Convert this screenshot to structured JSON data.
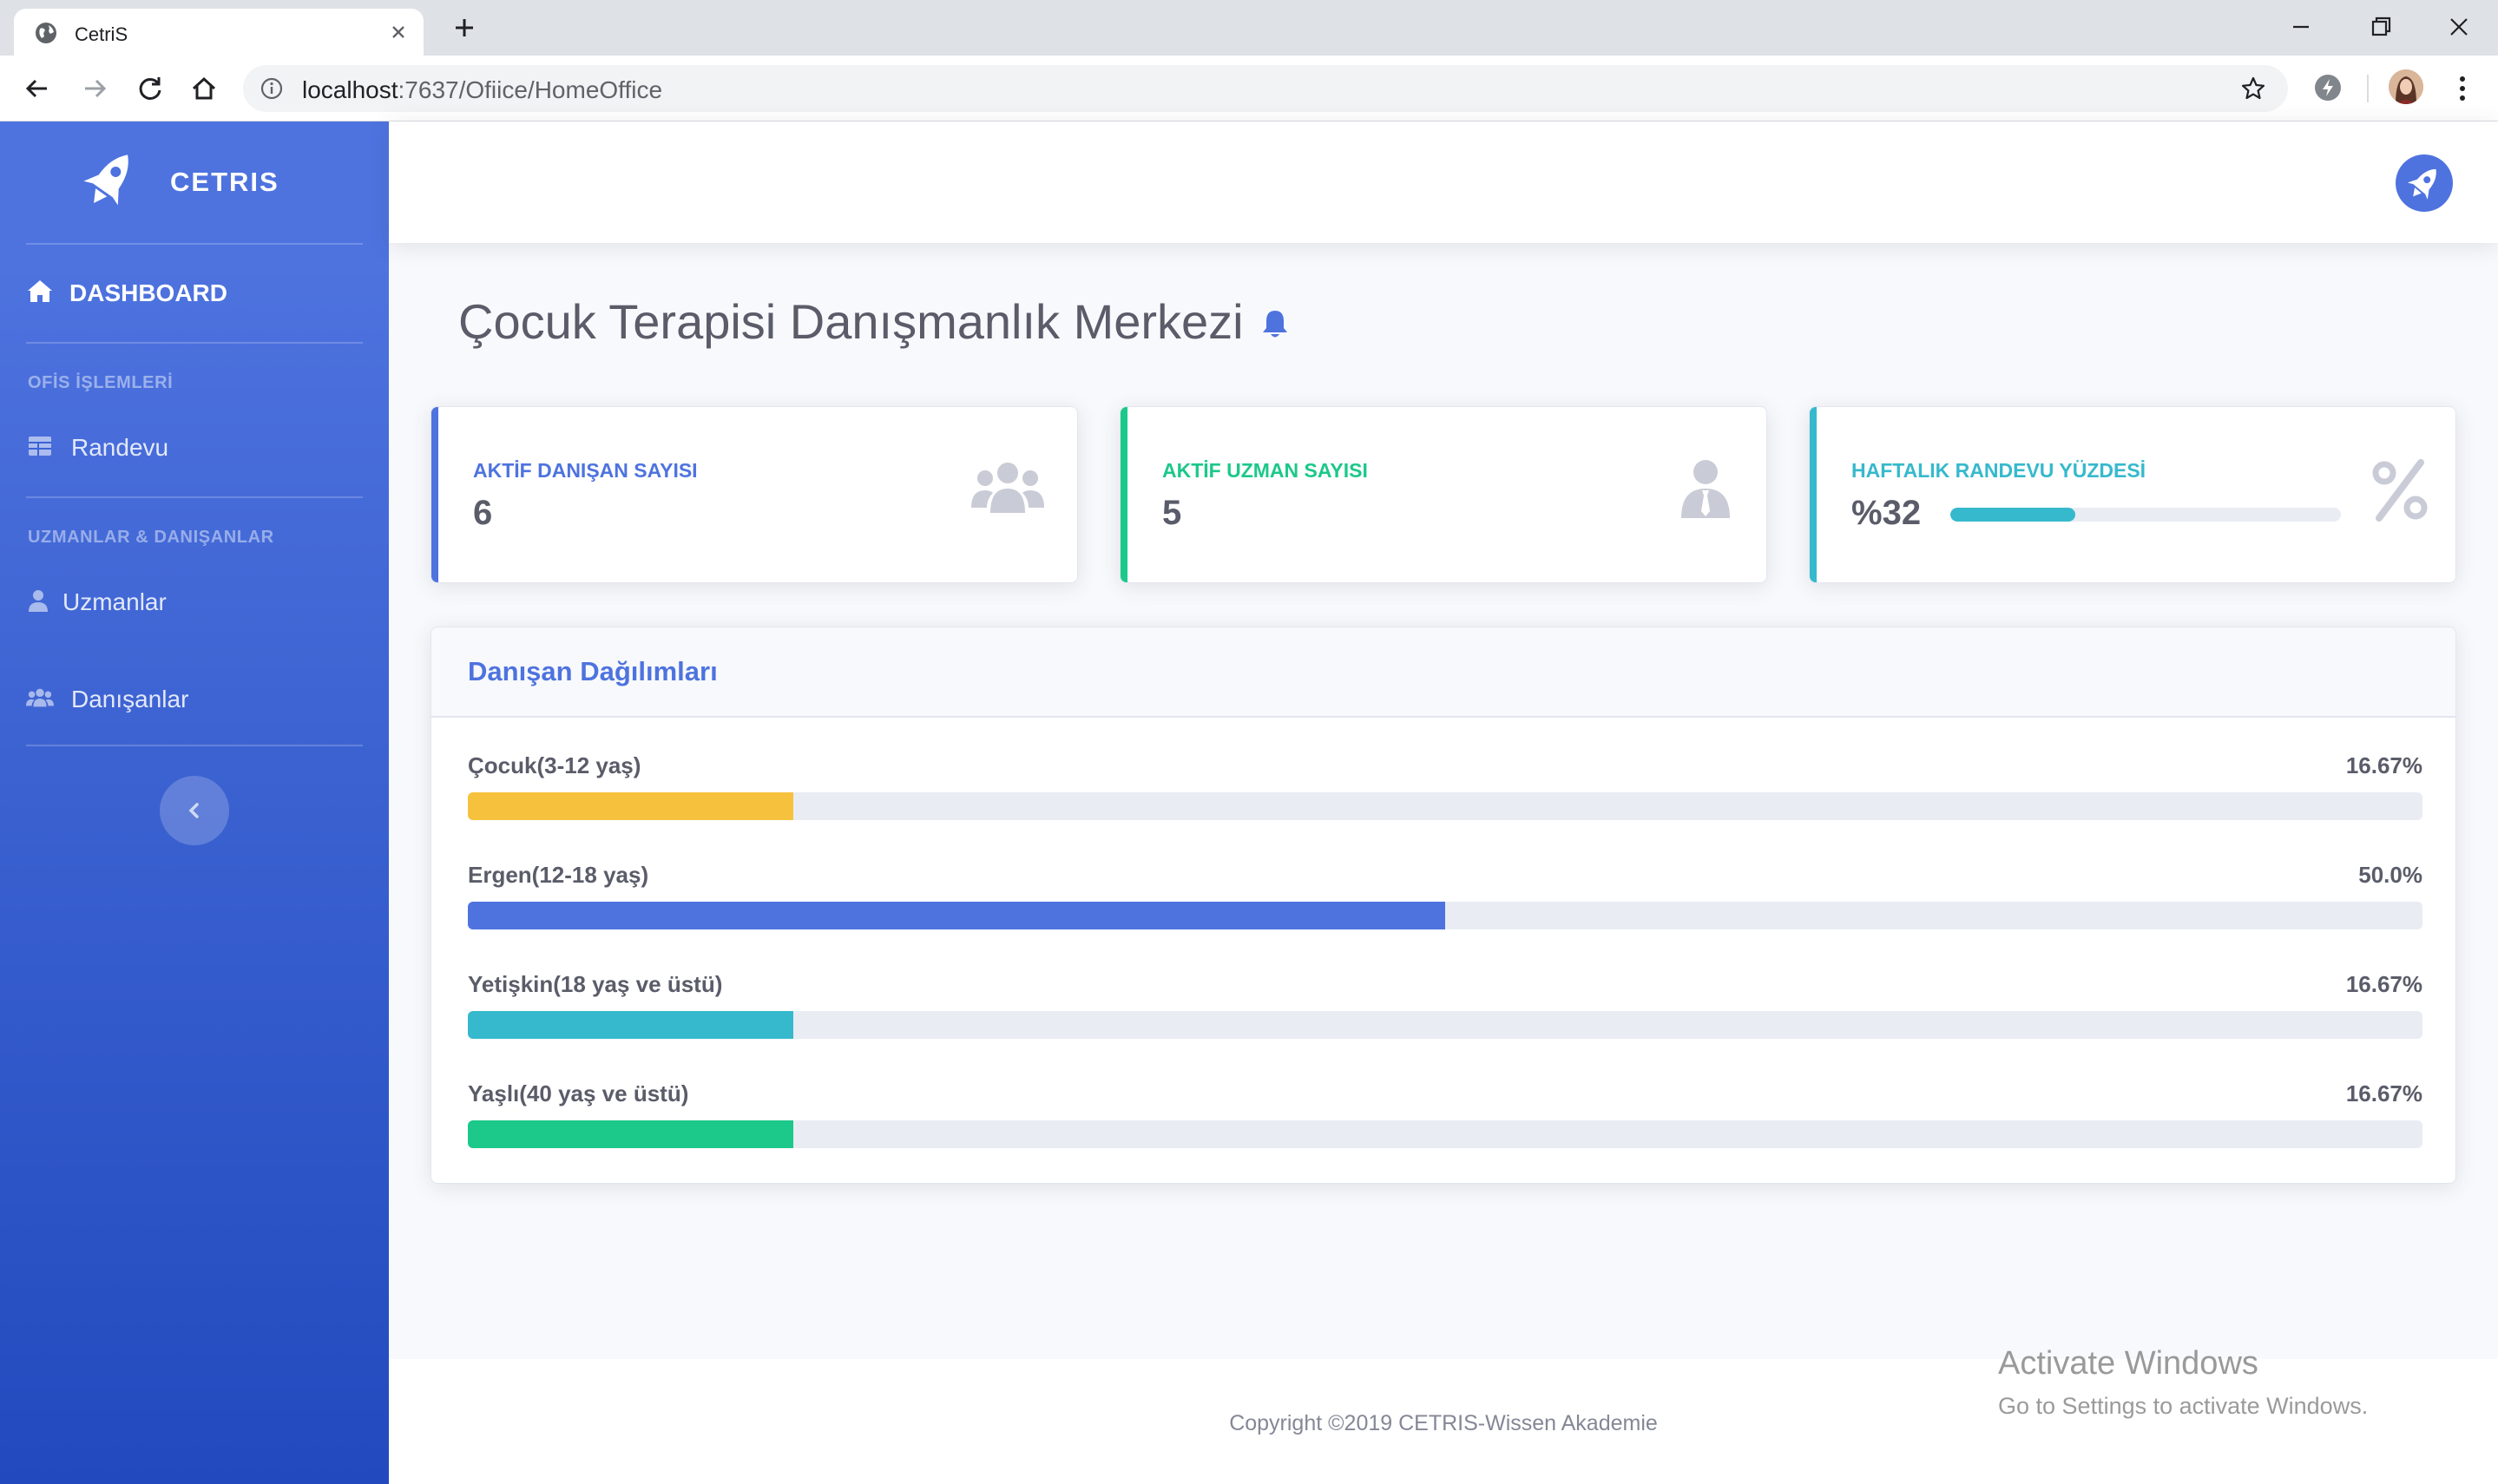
{
  "browser": {
    "tab_title": "CetriS",
    "url_host": "localhost",
    "url_rest": ":7637/Ofiice/HomeOffice"
  },
  "sidebar": {
    "brand": "CETRIS",
    "dashboard_label": "DASHBOARD",
    "sections": [
      {
        "heading": "OFİS İŞLEMLERİ",
        "items": [
          {
            "label": "Randevu",
            "icon": "table-icon"
          }
        ]
      },
      {
        "heading": "UZMANLAR & DANIŞANLAR",
        "items": [
          {
            "label": "Uzmanlar",
            "icon": "user-icon"
          },
          {
            "label": "Danışanlar",
            "icon": "users-icon"
          }
        ]
      }
    ]
  },
  "page": {
    "title": "Çocuk Terapisi Danışmanlık Merkezi"
  },
  "cards": [
    {
      "label": "AKTİF DANIŞAN SAYISI",
      "value": "6",
      "color": "#4e73df",
      "icon": "users-icon"
    },
    {
      "label": "AKTİF UZMAN SAYISI",
      "value": "5",
      "color": "#1cc88a",
      "icon": "user-tie-icon"
    },
    {
      "label": "HAFTALIK RANDEVU YÜZDESİ",
      "value": "%32",
      "progress": 0.32,
      "color": "#36b9cc",
      "icon": "percent-icon"
    }
  ],
  "distribution": {
    "title": "Danışan Dağılımları",
    "rows": [
      {
        "label": "Çocuk(3-12 yaş)",
        "value": "16.67%",
        "percent": 16.67,
        "color": "#f6c23e"
      },
      {
        "label": "Ergen(12-18 yaş)",
        "value": "50.0%",
        "percent": 50.0,
        "color": "#4e73df"
      },
      {
        "label": "Yetişkin(18 yaş ve üstü)",
        "value": "16.67%",
        "percent": 16.67,
        "color": "#36b9cc"
      },
      {
        "label": "Yaşlı(40 yaş ve üstü)",
        "value": "16.67%",
        "percent": 16.67,
        "color": "#1cc88a"
      }
    ]
  },
  "footer": {
    "text": "Copyright ©2019 CETRIS-Wissen Akademie"
  },
  "watermark": {
    "line1": "Activate Windows",
    "line2": "Go to Settings to activate Windows."
  }
}
